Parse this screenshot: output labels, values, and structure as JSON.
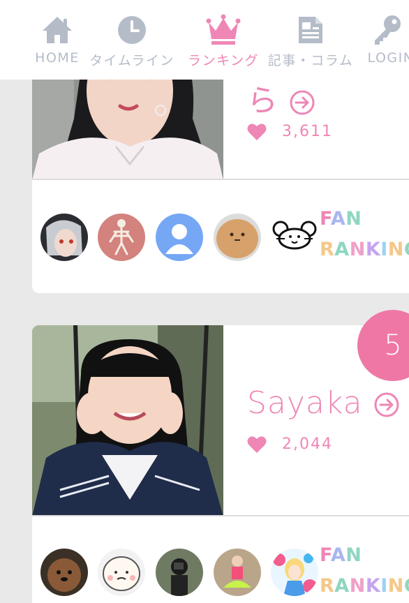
{
  "nav": {
    "items": [
      {
        "label": "HOME",
        "icon": "home-icon"
      },
      {
        "label": "タイムライン",
        "icon": "clock-icon"
      },
      {
        "label": "ランキング",
        "icon": "crown-icon"
      },
      {
        "label": "記事・コラム",
        "icon": "document-icon"
      },
      {
        "label": "LOGIN",
        "icon": "key-icon"
      }
    ],
    "active_color": "#ee86b6",
    "inactive_color": "#b4bcc8"
  },
  "ranking": [
    {
      "name_tail": "ら",
      "likes": "3,611",
      "fans": [
        "fan-avatar-silver-hair",
        "fan-avatar-skeleton",
        "fan-avatar-default",
        "fan-avatar-bread",
        "fan-avatar-mouse"
      ]
    },
    {
      "rank": "5",
      "name": "Sayaka",
      "likes": "2,044",
      "fans": [
        "fan-avatar-poodle",
        "fan-avatar-drawing",
        "fan-avatar-camera",
        "fan-avatar-dancer",
        "fan-avatar-alice"
      ]
    }
  ],
  "fan_ranking": {
    "line1": [
      "F",
      "A",
      "N"
    ],
    "line2": [
      "R",
      "A",
      "N",
      "K",
      "I",
      "N",
      "G"
    ],
    "colors": [
      "#ef86b6",
      "#a9b6f0",
      "#8fd6c2",
      "#f4c88a",
      "#f1a0c8",
      "#c5a4ee",
      "#9bd3f2"
    ]
  },
  "colors": {
    "accent": "#ee86b6",
    "badge": "#ef77a6",
    "background": "#e9e9e9"
  }
}
